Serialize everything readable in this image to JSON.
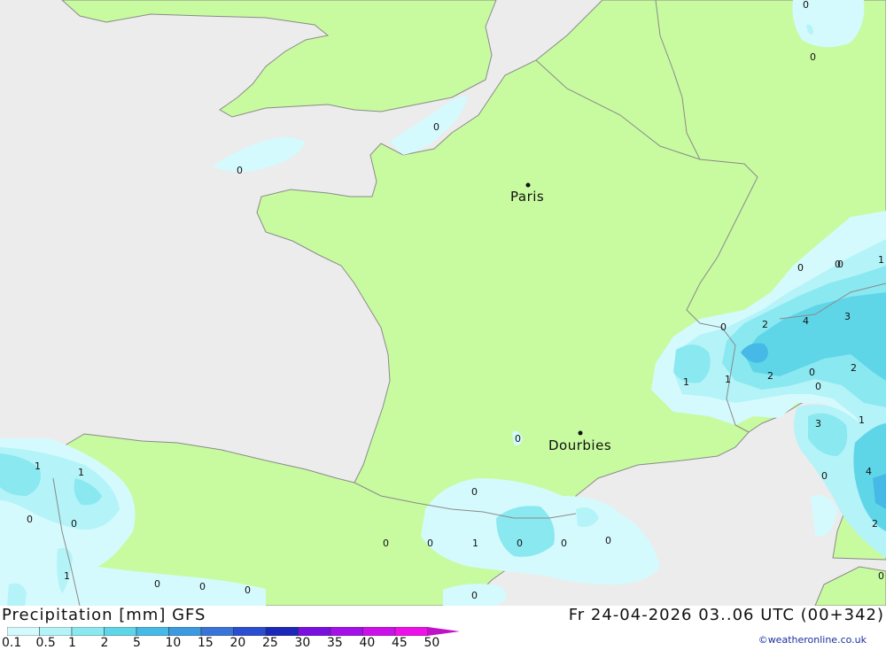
{
  "title": "Precipitation [mm] GFS",
  "datetime": "Fr 24-04-2026 03..06 UTC (00+342)",
  "credit": "©weatheronline.co.uk",
  "cities": [
    {
      "name": "Paris"
    },
    {
      "name": "Dourbies"
    }
  ],
  "values": [
    "0",
    "0",
    "0",
    "0",
    "0",
    "0",
    "0",
    "2",
    "4",
    "3",
    "1",
    "1",
    "1",
    "2",
    "0",
    "2",
    "3",
    "1",
    "0",
    "4",
    "2",
    "0",
    "0",
    "1",
    "1",
    "0",
    "0",
    "1",
    "0",
    "0",
    "0",
    "0",
    "0",
    "1",
    "0",
    "0",
    "0",
    "0",
    "0",
    "0",
    "0"
  ],
  "legend": {
    "labels": [
      "0.1",
      "0.5",
      "1",
      "2",
      "5",
      "10",
      "15",
      "20",
      "25",
      "30",
      "35",
      "40",
      "45",
      "50"
    ],
    "colors": [
      "#d4fafd",
      "#b4f3f8",
      "#8ae8f0",
      "#5fd6e8",
      "#46b9e6",
      "#3c9ae0",
      "#3a74d9",
      "#2a4ed0",
      "#1b28b8",
      "#7a10e0",
      "#a410e8",
      "#cc10ea",
      "#ee10e8",
      "#c010c8"
    ]
  }
}
